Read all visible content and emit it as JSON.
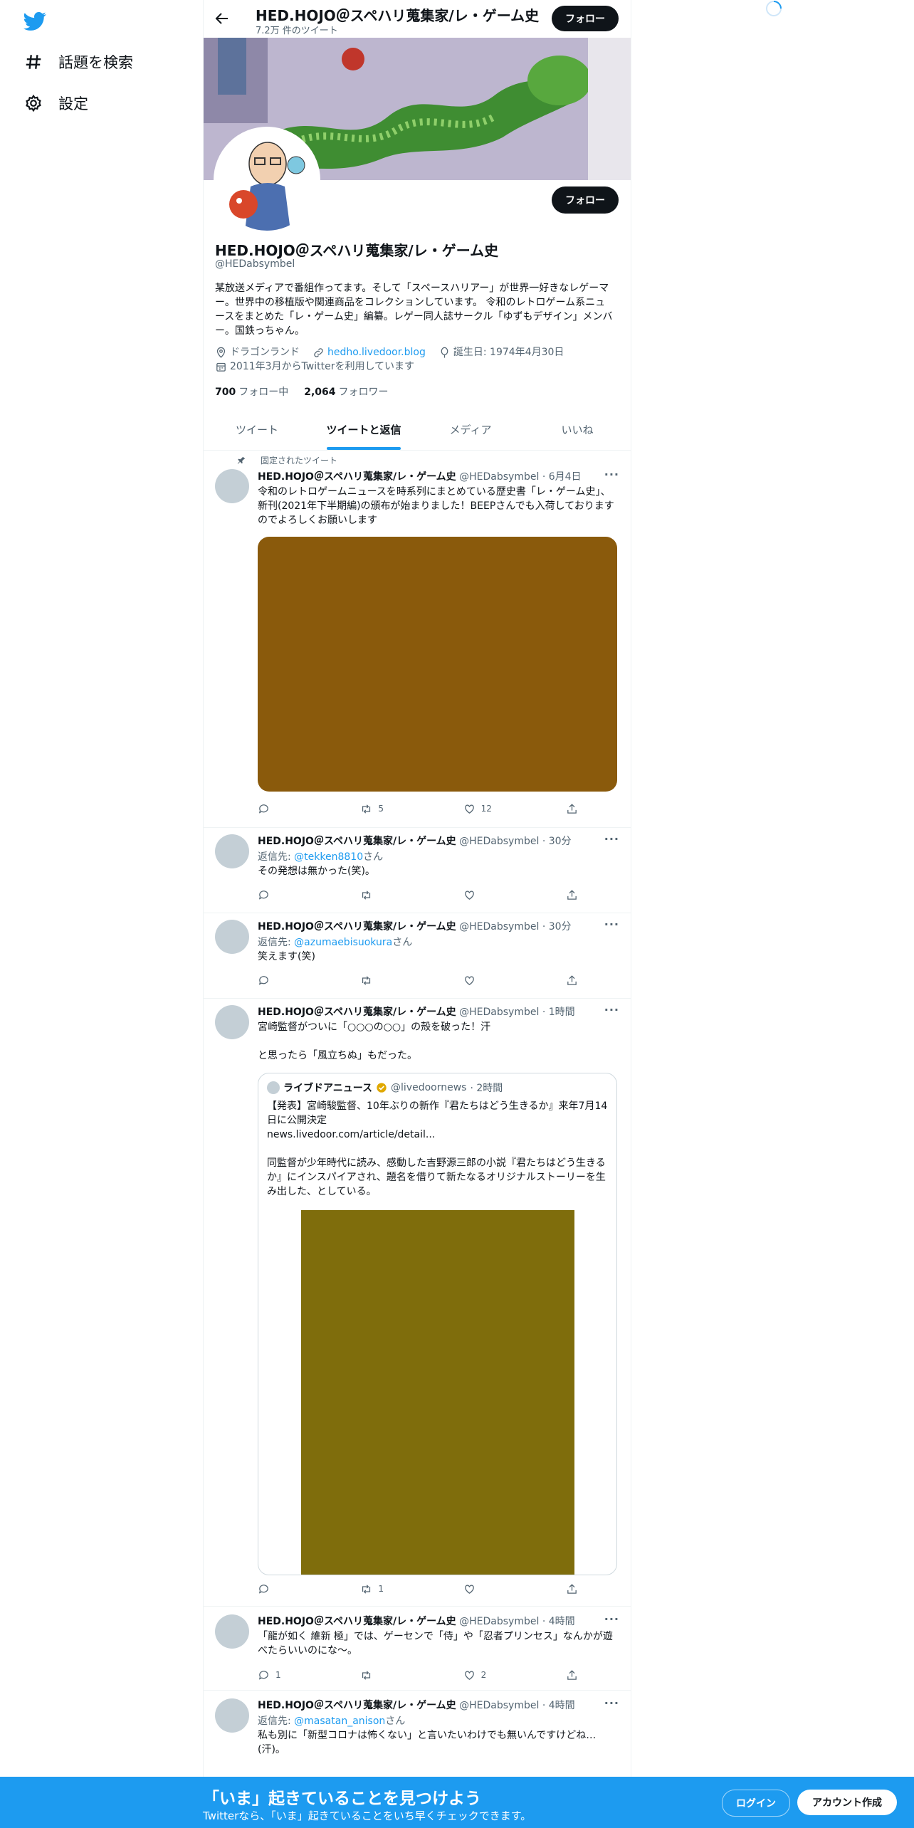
{
  "nav": {
    "explore_label": "話題を検索",
    "settings_label": "設定"
  },
  "header": {
    "name": "HED.HOJO＠スペハリ蒐集家/レ・ゲーム史",
    "tweet_count": "7.2万 件のツイート",
    "follow_label": "フォロー"
  },
  "profile": {
    "name": "HED.HOJO＠スペハリ蒐集家/レ・ゲーム史",
    "handle": "@HEDabsymbel",
    "follow_label": "フォロー",
    "bio": "某放送メディアで番組作ってます。そして「スペースハリアー」が世界一好きなレゲーマー。世界中の移植版や関連商品をコレクションしています。 令和のレトロゲーム系ニュースをまとめた「レ・ゲーム史」編纂。レゲー同人誌サークル「ゆずもデザイン」メンバー。国鉄っちゃん。",
    "location": "ドラゴンランド",
    "url": "hedho.livedoor.blog",
    "birthday": "誕生日: 1974年4月30日",
    "joined": "2011年3月からTwitterを利用しています",
    "following_count": "700",
    "following_label": "フォロー中",
    "followers_count": "2,064",
    "followers_label": "フォロワー"
  },
  "tabs": [
    "ツイート",
    "ツイートと返信",
    "メディア",
    "いいね"
  ],
  "tweets": [
    {
      "pinned_label": "固定されたツイート",
      "name": "HED.HOJO＠スペハリ蒐集家/レ・ゲーム史",
      "handle": "@HEDabsymbel",
      "time": "· 6月4日",
      "text": "令和のレトロゲームニュースを時系列にまとめている歴史書「レ・ゲーム史」、新刊(2021年下半期編)の頒布が始まりました！BEEPさんでも入荷しておりますのでよろしくお願いします",
      "media_color": "#8a5a0c",
      "retweets": "5",
      "likes": "12"
    },
    {
      "name": "HED.HOJO＠スペハリ蒐集家/レ・ゲーム史",
      "handle": "@HEDabsymbel",
      "time": "· 30分",
      "reply_prefix": "返信先: ",
      "reply_to": "@tekken8810",
      "reply_suffix": "さん",
      "text": "その発想は無かった(笑)。"
    },
    {
      "name": "HED.HOJO＠スペハリ蒐集家/レ・ゲーム史",
      "handle": "@HEDabsymbel",
      "time": "· 30分",
      "reply_prefix": "返信先: ",
      "reply_to": "@azumaebisuokura",
      "reply_suffix": "さん",
      "text": "笑えます(笑)"
    },
    {
      "name": "HED.HOJO＠スペハリ蒐集家/レ・ゲーム史",
      "handle": "@HEDabsymbel",
      "time": "· 1時間",
      "text": "宮崎監督がついに「○○○の○○」の殻を破った！汗\n\nと思ったら「風立ちぬ」もだった。",
      "quote": {
        "name": "ライブドアニュース",
        "handle": "@livedoornews",
        "time": "· 2時間",
        "text": "【発表】宮崎駿監督、10年ぶりの新作『君たちはどう生きるか』来年7月14日に公開決定\nnews.livedoor.com/article/detail...\n\n同監督が少年時代に読み、感動した吉野源三郎の小説『君たちはどう生きるか』にインスパイアされ、題名を借りて新たなるオリジナルストーリーを生み出した、としている。",
        "media_color": "#7f6d0c"
      },
      "retweets": "1"
    },
    {
      "name": "HED.HOJO＠スペハリ蒐集家/レ・ゲーム史",
      "handle": "@HEDabsymbel",
      "time": "· 4時間",
      "text": "「龍が如く 維新 極」では、ゲーセンで「侍」や「忍者プリンセス」なんかが遊べたらいいのにな～。",
      "replies": "1",
      "likes": "2"
    },
    {
      "name": "HED.HOJO＠スペハリ蒐集家/レ・ゲーム史",
      "handle": "@HEDabsymbel",
      "time": "· 4時間",
      "reply_prefix": "返信先: ",
      "reply_to": "@masatan_anison",
      "reply_suffix": "さん",
      "text": "私も別に「新型コロナは怖くない」と言いたいわけでも無いんですけどね…(汗)。"
    }
  ],
  "bottom_bar": {
    "title": "「いま」起きていることを見つけよう",
    "subtitle": "Twitterなら、「いま」起きていることをいち早くチェックできます。",
    "login_label": "ログイン",
    "signup_label": "アカウント作成"
  },
  "colors": {
    "accent": "#1d9bf0",
    "text": "#0f1419",
    "muted": "#536471"
  },
  "icons": [
    "twitter-logo-icon",
    "hashtag-icon",
    "gear-icon",
    "back-arrow-icon",
    "location-icon",
    "link-icon",
    "balloon-icon",
    "calendar-icon",
    "pin-icon",
    "reply-icon",
    "retweet-icon",
    "like-icon",
    "share-icon",
    "more-icon",
    "verified-icon",
    "loading-spinner-icon"
  ]
}
